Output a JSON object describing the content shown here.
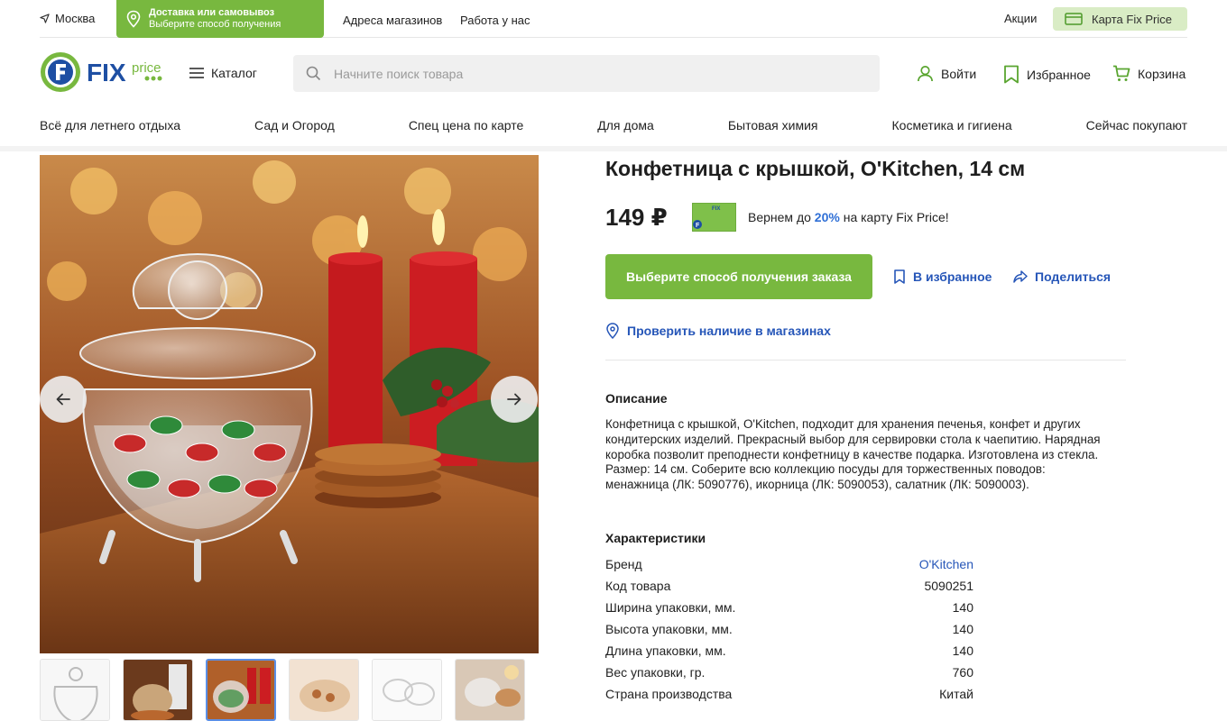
{
  "topbar": {
    "city": "Москва",
    "delivery_title": "Доставка или самовывоз",
    "delivery_sub": "Выберите способ получения",
    "links": [
      "Адреса магазинов",
      "Работа у нас"
    ],
    "promo": "Акции",
    "card": "Карта Fix Price"
  },
  "header": {
    "catalog": "Каталог",
    "search_placeholder": "Начните поиск товара",
    "login": "Войти",
    "favorites": "Избранное",
    "cart": "Корзина"
  },
  "categories": [
    "Всё для летнего отдыха",
    "Сад и Огород",
    "Спец цена по карте",
    "Для дома",
    "Бытовая химия",
    "Косметика и гигиена",
    "Сейчас покупают"
  ],
  "product": {
    "title": "Конфетница с крышкой, O'Kitchen, 14 см",
    "price": "149 ₽",
    "cashback_pre": "Вернем до ",
    "cashback_pct": "20%",
    "cashback_post": " на карту Fix Price!",
    "order_button": "Выберите способ получения заказа",
    "favorite_link": "В избранное",
    "share_link": "Поделиться",
    "stores_link": "Проверить наличие в магазинах",
    "description_title": "Описание",
    "description": "Конфетница с крышкой, O'Kitchen, подходит для хранения печенья, конфет и других кондитерских изделий. Прекрасный выбор для сервировки стола к чаепитию. Нарядная коробка позволит преподнести конфетницу в качестве подарка. Изготовлена из стекла. Размер: 14 см. Соберите всю коллекцию посуды для торжественных поводов: менажница (ЛК: 5090776), икорница (ЛК: 5090053), салатник (ЛК: 5090003).",
    "characteristics_title": "Характеристики",
    "characteristics": [
      {
        "label": "Бренд",
        "value": "O'Kitchen"
      },
      {
        "label": "Код товара",
        "value": "5090251"
      },
      {
        "label": "Ширина упаковки, мм.",
        "value": "140"
      },
      {
        "label": "Высота упаковки, мм.",
        "value": "140"
      },
      {
        "label": "Длина упаковки, мм.",
        "value": "140"
      },
      {
        "label": "Вес упаковки, гр.",
        "value": "760"
      },
      {
        "label": "Страна производства",
        "value": "Китай"
      }
    ]
  },
  "colors": {
    "green": "#78b83f",
    "blue": "#2656b8",
    "logo_blue": "#1e4fa3"
  }
}
